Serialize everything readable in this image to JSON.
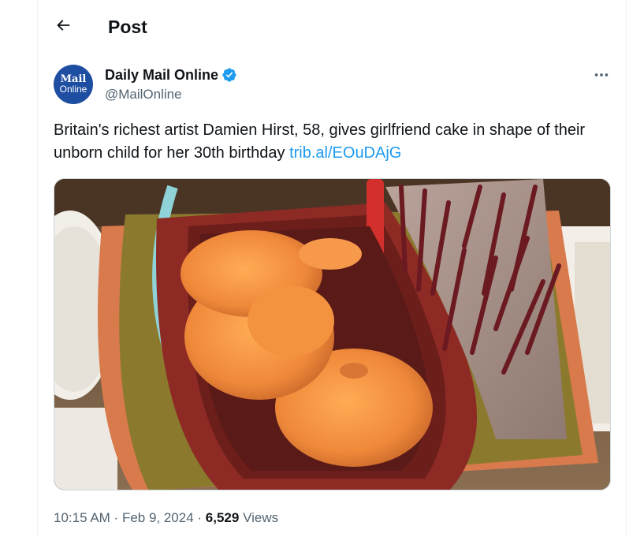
{
  "header": {
    "title": "Post"
  },
  "author": {
    "avatar_line1": "Mail",
    "avatar_line2": "Online",
    "name": "Daily Mail Online",
    "handle": "@MailOnline"
  },
  "tweet": {
    "text": "Britain's richest artist Damien Hirst, 58, gives girlfriend cake in shape of their unborn child for her 30th birthday ",
    "link": "trib.al/EOuDAjG"
  },
  "meta": {
    "time": "10:15 AM",
    "sep1": " · ",
    "date": "Feb 9, 2024",
    "sep2": " · ",
    "views_count": "6,529",
    "views_label": " Views"
  },
  "colors": {
    "accent": "#1d9bf0",
    "avatar_bg": "#1d4ea1",
    "secondary_text": "#536471"
  },
  "icons": {
    "back": "arrow-left-icon",
    "verified": "verified-badge-icon",
    "more": "more-horizontal-icon"
  }
}
